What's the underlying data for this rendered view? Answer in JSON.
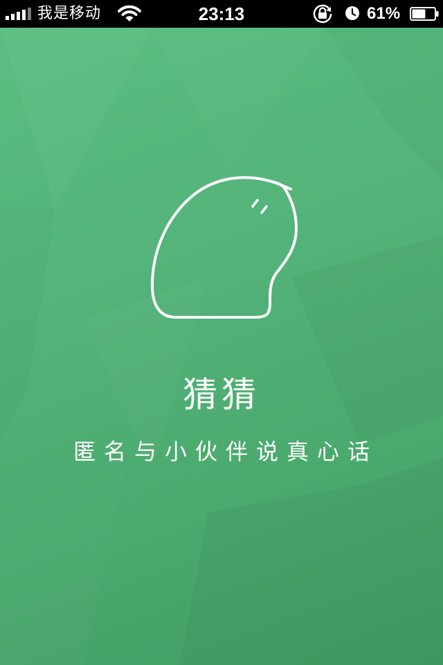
{
  "status_bar": {
    "carrier": "我是移动",
    "time": "23:13",
    "battery_percent": "61%",
    "battery_level": 0.61,
    "signal_bars_filled": 4,
    "signal_bars_total": 5,
    "icons": [
      "signal-icon",
      "wifi-icon",
      "lock-rotation-icon",
      "alarm-icon",
      "battery-icon"
    ]
  },
  "splash": {
    "app_name": "猜猜",
    "slogan": "匿名与小伙伴说真心话",
    "logo_icon": "mascot-blob-icon",
    "colors": {
      "background_top": "#5bbd80",
      "background_bottom": "#409c62",
      "foreground": "#ffffff"
    }
  }
}
